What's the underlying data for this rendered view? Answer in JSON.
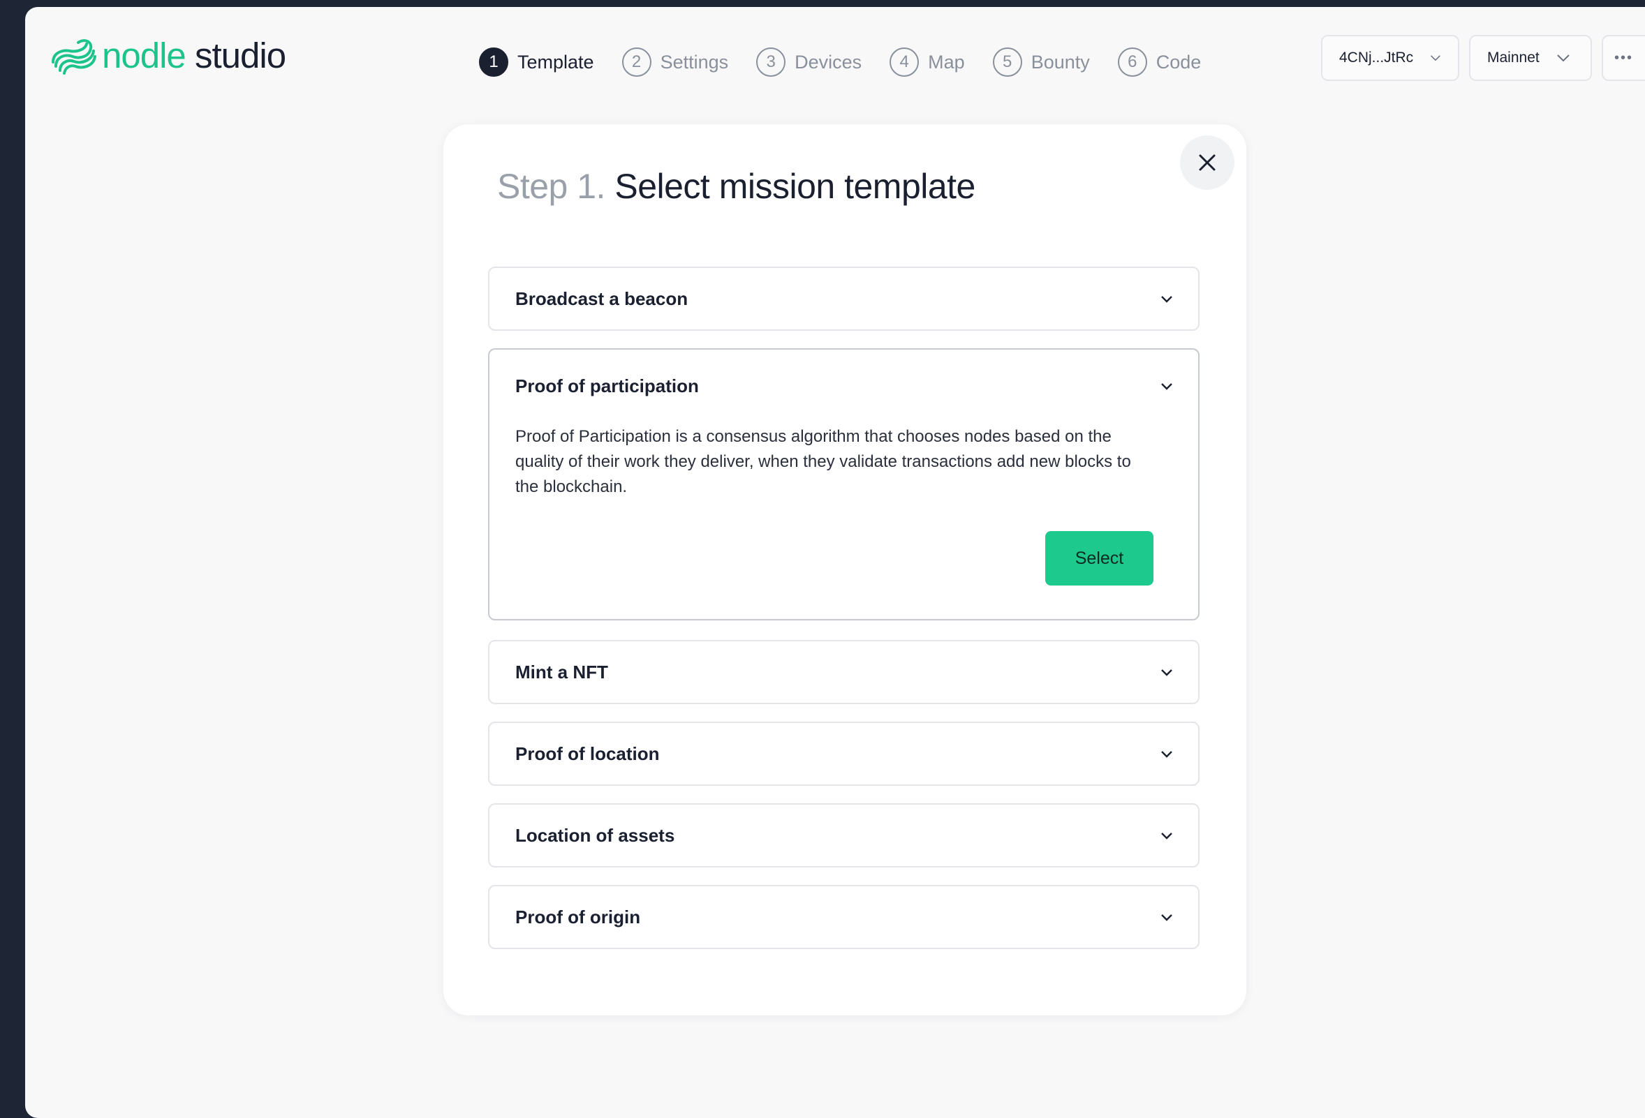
{
  "brand": {
    "name_part1": "nodle",
    "name_part2": "studio",
    "accent_color": "#1cc48c"
  },
  "stepper": [
    {
      "num": "1",
      "label": "Template",
      "active": true
    },
    {
      "num": "2",
      "label": "Settings",
      "active": false
    },
    {
      "num": "3",
      "label": "Devices",
      "active": false
    },
    {
      "num": "4",
      "label": "Map",
      "active": false
    },
    {
      "num": "5",
      "label": "Bounty",
      "active": false
    },
    {
      "num": "6",
      "label": "Code",
      "active": false
    }
  ],
  "header": {
    "wallet_label": "4CNj...JtRc",
    "network_label": "Mainnet",
    "more_label": "•••"
  },
  "modal": {
    "step_prefix": "Step 1.",
    "title": "Select mission template",
    "close_icon": "close-icon",
    "templates": [
      {
        "title": "Broadcast a beacon"
      },
      {
        "title": "Proof of participation",
        "description": "Proof of Participation is a consensus algorithm that chooses nodes based on the quality of their work they deliver, when they validate transactions add new blocks to the blockchain.",
        "select_label": "Select"
      },
      {
        "title": "Mint a NFT"
      },
      {
        "title": "Proof of location"
      },
      {
        "title": "Location of assets"
      },
      {
        "title": "Proof of origin"
      }
    ]
  }
}
